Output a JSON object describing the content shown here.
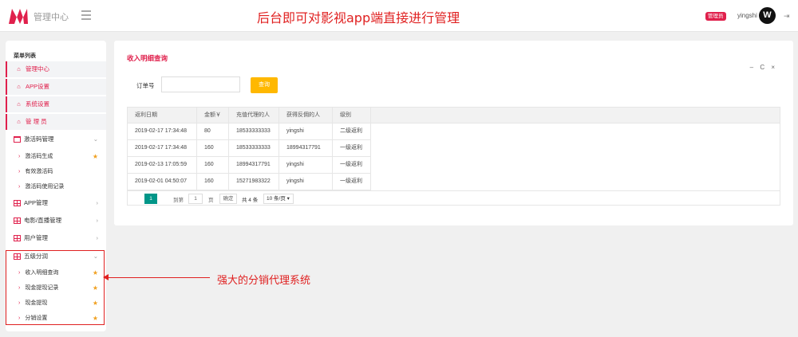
{
  "header": {
    "brand": "管理中心",
    "headline": "后台即可对影视app端直接进行管理",
    "role_badge": "管理员",
    "username": "yingshi",
    "avatar_letter": "W",
    "logout_icon": "logout-icon",
    "accent_color": "#e0204c"
  },
  "sidebar": {
    "title": "菜单列表",
    "items": [
      {
        "label": "管理中心"
      },
      {
        "label": "APP设置"
      },
      {
        "label": "系统设置"
      },
      {
        "label": "管 理 员"
      },
      {
        "label": "激活码管理"
      },
      {
        "label": "激活码生成"
      },
      {
        "label": "有效激活码"
      },
      {
        "label": "激活码使用记录"
      },
      {
        "label": "APP管理"
      },
      {
        "label": "电影/直播管理"
      },
      {
        "label": "用户管理"
      },
      {
        "label": "五级分润"
      },
      {
        "label": "收入明细查询"
      },
      {
        "label": "现金提现记录"
      },
      {
        "label": "现金提现"
      },
      {
        "label": "分销设置"
      }
    ]
  },
  "main": {
    "title": "收入明细查询",
    "tools": "– C ×",
    "search": {
      "label": "订单号",
      "value": "",
      "button": "查询"
    },
    "table": {
      "columns": [
        "返利日期",
        "金额￥",
        "充值代理的人",
        "获得反佣的人",
        "级别"
      ],
      "rows": [
        [
          "2019-02-17 17:34:48",
          "80",
          "18533333333",
          "yingshi",
          "二级返利"
        ],
        [
          "2019-02-17 17:34:48",
          "160",
          "18533333333",
          "18994317791",
          "一级返利"
        ],
        [
          "2019-02-13 17:05:59",
          "160",
          "18994317791",
          "yingshi",
          "一级返利"
        ],
        [
          "2019-02-01 04:50:07",
          "160",
          "15271983322",
          "yingshi",
          "一级返利"
        ]
      ]
    },
    "pager": {
      "current": "1",
      "goto_label": "到第",
      "goto_value": "1",
      "page_label": "页",
      "confirm": "确定",
      "total": "共 4 条",
      "page_size": "10 条/页 ▾"
    }
  },
  "annotation": {
    "text": "强大的分销代理系统",
    "color": "#e02020"
  }
}
